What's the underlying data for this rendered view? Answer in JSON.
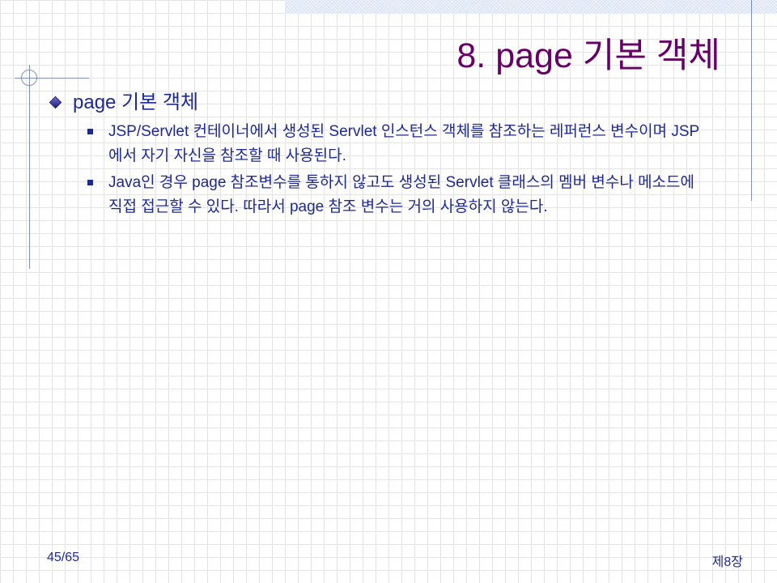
{
  "slide": {
    "title": "8. page 기본 객체",
    "bullets": [
      {
        "text": "page 기본 객체",
        "sub_bullets": [
          "JSP/Servlet 컨테이너에서 생성된 Servlet 인스턴스 객체를 참조하는 레퍼런스 변수이며 JSP에서 자기 자신을 참조할 때 사용된다.",
          "Java인 경우 page 참조변수를 통하지 않고도 생성된 Servlet 클래스의 멤버 변수나 메소드에 직접 접근할 수 있다. 따라서 page 참조 변수는 거의 사용하지 않는다."
        ]
      }
    ]
  },
  "footer": {
    "page_number": "45/65",
    "chapter": "제8장"
  },
  "icons": {
    "level1_bullet": "diamond-bullet-icon",
    "level2_bullet": "square-bullet-icon"
  },
  "colors": {
    "title": "#660066",
    "body_text": "#1f2a8f",
    "accent_line": "#7f8fc0",
    "grid": "#e3e3e3"
  }
}
